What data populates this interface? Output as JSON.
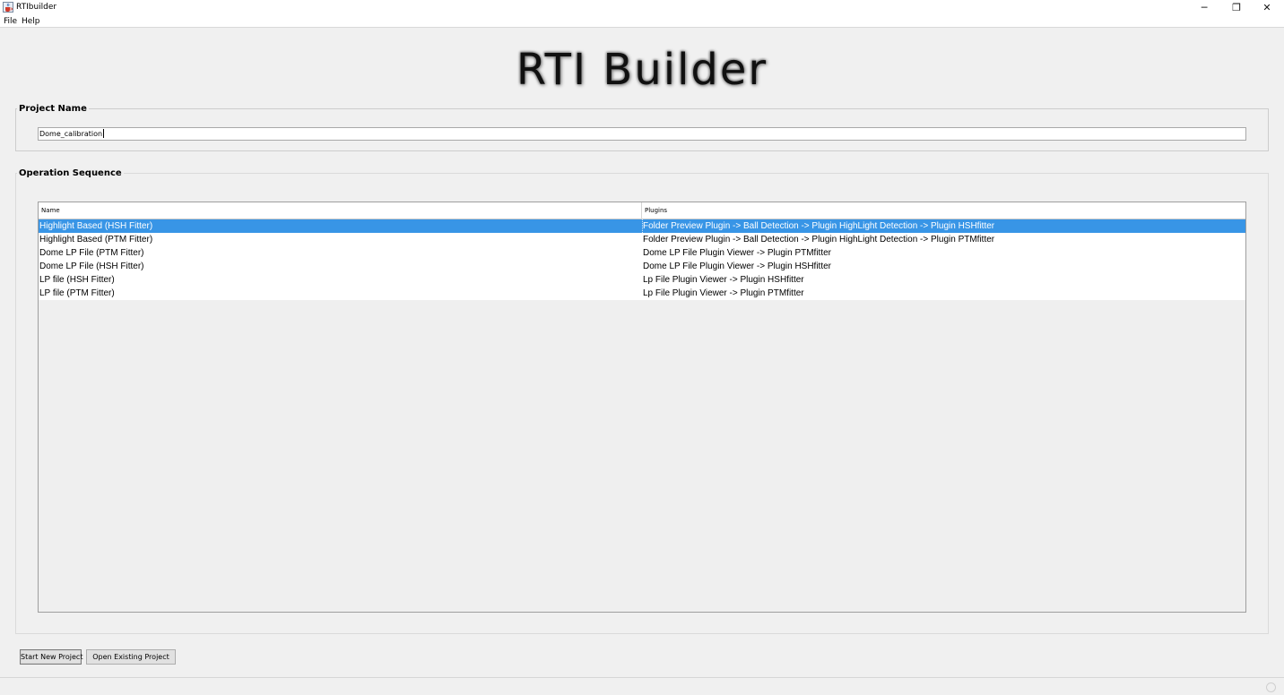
{
  "window": {
    "title": "RTIbuilder",
    "icon": "java-cup-icon",
    "controls": {
      "minimize": "─",
      "restore": "❐",
      "close": "✕"
    }
  },
  "menu": {
    "file": "File",
    "help": "Help"
  },
  "logo_text": "RTI Builder",
  "project": {
    "section_title": "Project Name",
    "name_value": "Dome_calibration"
  },
  "operations": {
    "section_title": "Operation Sequence",
    "columns": {
      "name": "Name",
      "plugins": "Plugins"
    },
    "selected_index": 0,
    "rows": [
      {
        "name": "Highlight Based (HSH Fitter)",
        "plugins": "Folder Preview Plugin -> Ball Detection -> Plugin HighLight Detection -> Plugin HSHfitter"
      },
      {
        "name": "Highlight Based (PTM Fitter)",
        "plugins": "Folder Preview Plugin -> Ball Detection -> Plugin HighLight Detection -> Plugin PTMfitter"
      },
      {
        "name": "Dome LP File (PTM Fitter)",
        "plugins": "Dome LP File Plugin Viewer -> Plugin PTMfitter"
      },
      {
        "name": "Dome LP File (HSH Fitter)",
        "plugins": "Dome LP File Plugin Viewer -> Plugin HSHfitter"
      },
      {
        "name": "LP file (HSH Fitter)",
        "plugins": "Lp File Plugin Viewer -> Plugin HSHfitter"
      },
      {
        "name": "LP file (PTM Fitter)",
        "plugins": "Lp File Plugin Viewer -> Plugin PTMfitter"
      }
    ]
  },
  "buttons": {
    "start_new": "Start New Project",
    "open_existing": "Open Existing Project"
  },
  "colors": {
    "selection": "#3895e6",
    "background": "#f0f0f0"
  }
}
